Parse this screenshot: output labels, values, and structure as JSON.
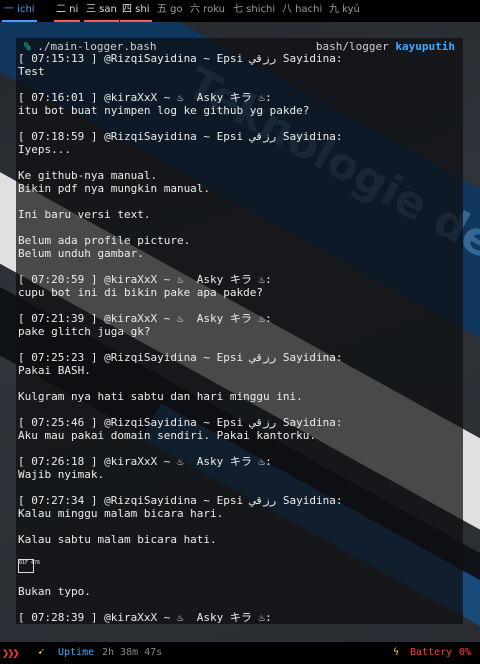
{
  "workspaces": [
    {
      "label": "一 ichi",
      "state": "active"
    },
    {
      "label": "二 ni",
      "state": "used"
    },
    {
      "label": "三 san",
      "state": "used"
    },
    {
      "label": "四 shi",
      "state": "used"
    },
    {
      "label": "五 go",
      "state": "idle"
    },
    {
      "label": "六 roku",
      "state": "idle"
    },
    {
      "label": "七 shichi",
      "state": "idle"
    },
    {
      "label": "八 hachi",
      "state": "idle"
    },
    {
      "label": "九 kyū",
      "state": "idle"
    }
  ],
  "terminal": {
    "prompt_symbol": "%",
    "command": "./main-logger.bash",
    "path": "bash/logger",
    "user": "kayuputih",
    "lines": [
      "[ 07:15:13 ] @RizqiSayidina ~ Epsi رزقي Sayidina:",
      "Test",
      "",
      "[ 07:16:01 ] @kiraXxX ~ ♨  Asky キラ ♨:",
      "itu bot buat nyimpen log ke github yg pakde?",
      "",
      "[ 07:18:59 ] @RizqiSayidina ~ Epsi رزقي Sayidina:",
      "Iyeps...",
      "",
      "Ke github-nya manual.",
      "Bikin pdf nya mungkin manual.",
      "",
      "Ini baru versi text.",
      "",
      "Belum ada profile picture.",
      "Belum unduh gambar.",
      "",
      "[ 07:20:59 ] @kiraXxX ~ ♨  Asky キラ ♨:",
      "cupu bot ini di bikin pake apa pakde?",
      "",
      "[ 07:21:39 ] @kiraXxX ~ ♨  Asky キラ ♨:",
      "pake glitch juga gk?",
      "",
      "[ 07:25:23 ] @RizqiSayidina ~ Epsi رزقي Sayidina:",
      "Pakai BASH.",
      "",
      "Kulgram nya hati sabtu dan hari minggu ini.",
      "",
      "[ 07:25:46 ] @RizqiSayidina ~ Epsi رزقي Sayidina:",
      "Aku mau pakai domain sendiri. Pakai kantorku.",
      "",
      "[ 07:26:18 ] @kiraXxX ~ ♨  Asky キラ ♨:",
      "Wajib nyimak.",
      "",
      "[ 07:27:34 ] @RizqiSayidina ~ Epsi رزقي Sayidina:",
      "Kalau minggu malam bicara hari.",
      "",
      "Kalau sabtu malam bicara hati.",
      "",
      "[ICON]",
      "",
      "Bukan typo.",
      "",
      "[ 07:28:39 ] @kiraXxX ~ ♨  Asky キラ ♨:"
    ],
    "icon_glyph": "01F 476"
  },
  "statusbar": {
    "uptime_label": "Uptime",
    "uptime_value": "2h 38m 47s",
    "battery_label": "Battery",
    "battery_value": "0%"
  },
  "wallpaper_text": "Teknologie debe complete",
  "colors": {
    "accent": "#3fa9ff",
    "alert": "#ff3b3b",
    "bolt": "#ffd000",
    "prompt": "#00e0a0"
  }
}
